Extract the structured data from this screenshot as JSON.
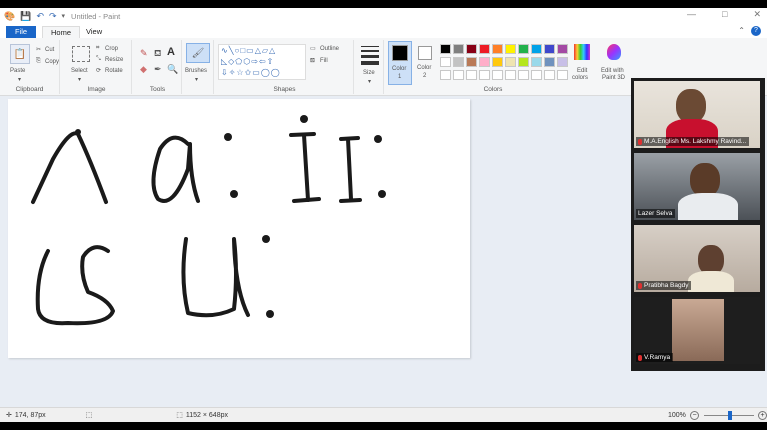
{
  "window": {
    "title": "Untitled - Paint",
    "min": "—",
    "max": "□",
    "close": "✕"
  },
  "tabs": {
    "file": "File",
    "home": "Home",
    "view": "View"
  },
  "ribbon": {
    "clipboard": {
      "paste": "Paste",
      "cut": "Cut",
      "copy": "Copy",
      "label": "Clipboard"
    },
    "image": {
      "select": "Select",
      "crop": "Crop",
      "resize": "Resize",
      "rotate": "Rotate",
      "label": "Image"
    },
    "tools": {
      "label": "Tools"
    },
    "brushes": {
      "label": "Brushes"
    },
    "shapes": {
      "outline": "Outline",
      "fill": "Fill",
      "label": "Shapes"
    },
    "size": {
      "label": "Size"
    },
    "color1": {
      "label": "Color",
      "num": "1"
    },
    "color2": {
      "label": "Color",
      "num": "2"
    },
    "colors": {
      "label": "Colors",
      "row1": [
        "#000000",
        "#7f7f7f",
        "#880015",
        "#ed1c24",
        "#ff7f27",
        "#fff200",
        "#22b14c",
        "#00a2e8",
        "#3f48cc",
        "#a349a4"
      ],
      "row2": [
        "#ffffff",
        "#c3c3c3",
        "#b97a57",
        "#ffaec9",
        "#ffc90e",
        "#efe4b0",
        "#b5e61d",
        "#99d9ea",
        "#7092be",
        "#c8bfe7"
      ]
    },
    "edit_colors": {
      "line1": "Edit",
      "line2": "colors"
    },
    "paint3d": {
      "line1": "Edit with",
      "line2": "Paint 3D"
    }
  },
  "participants": [
    {
      "name": "M.A.English Ms. Lakshmy Ravind..."
    },
    {
      "name": "Lazer Selva"
    },
    {
      "name": "Pratibha Bagdy"
    },
    {
      "name": "V.Ramya"
    }
  ],
  "status": {
    "cursor_pos": "174, 87px",
    "canvas_size": "1152 × 648px",
    "zoom": "100%"
  }
}
